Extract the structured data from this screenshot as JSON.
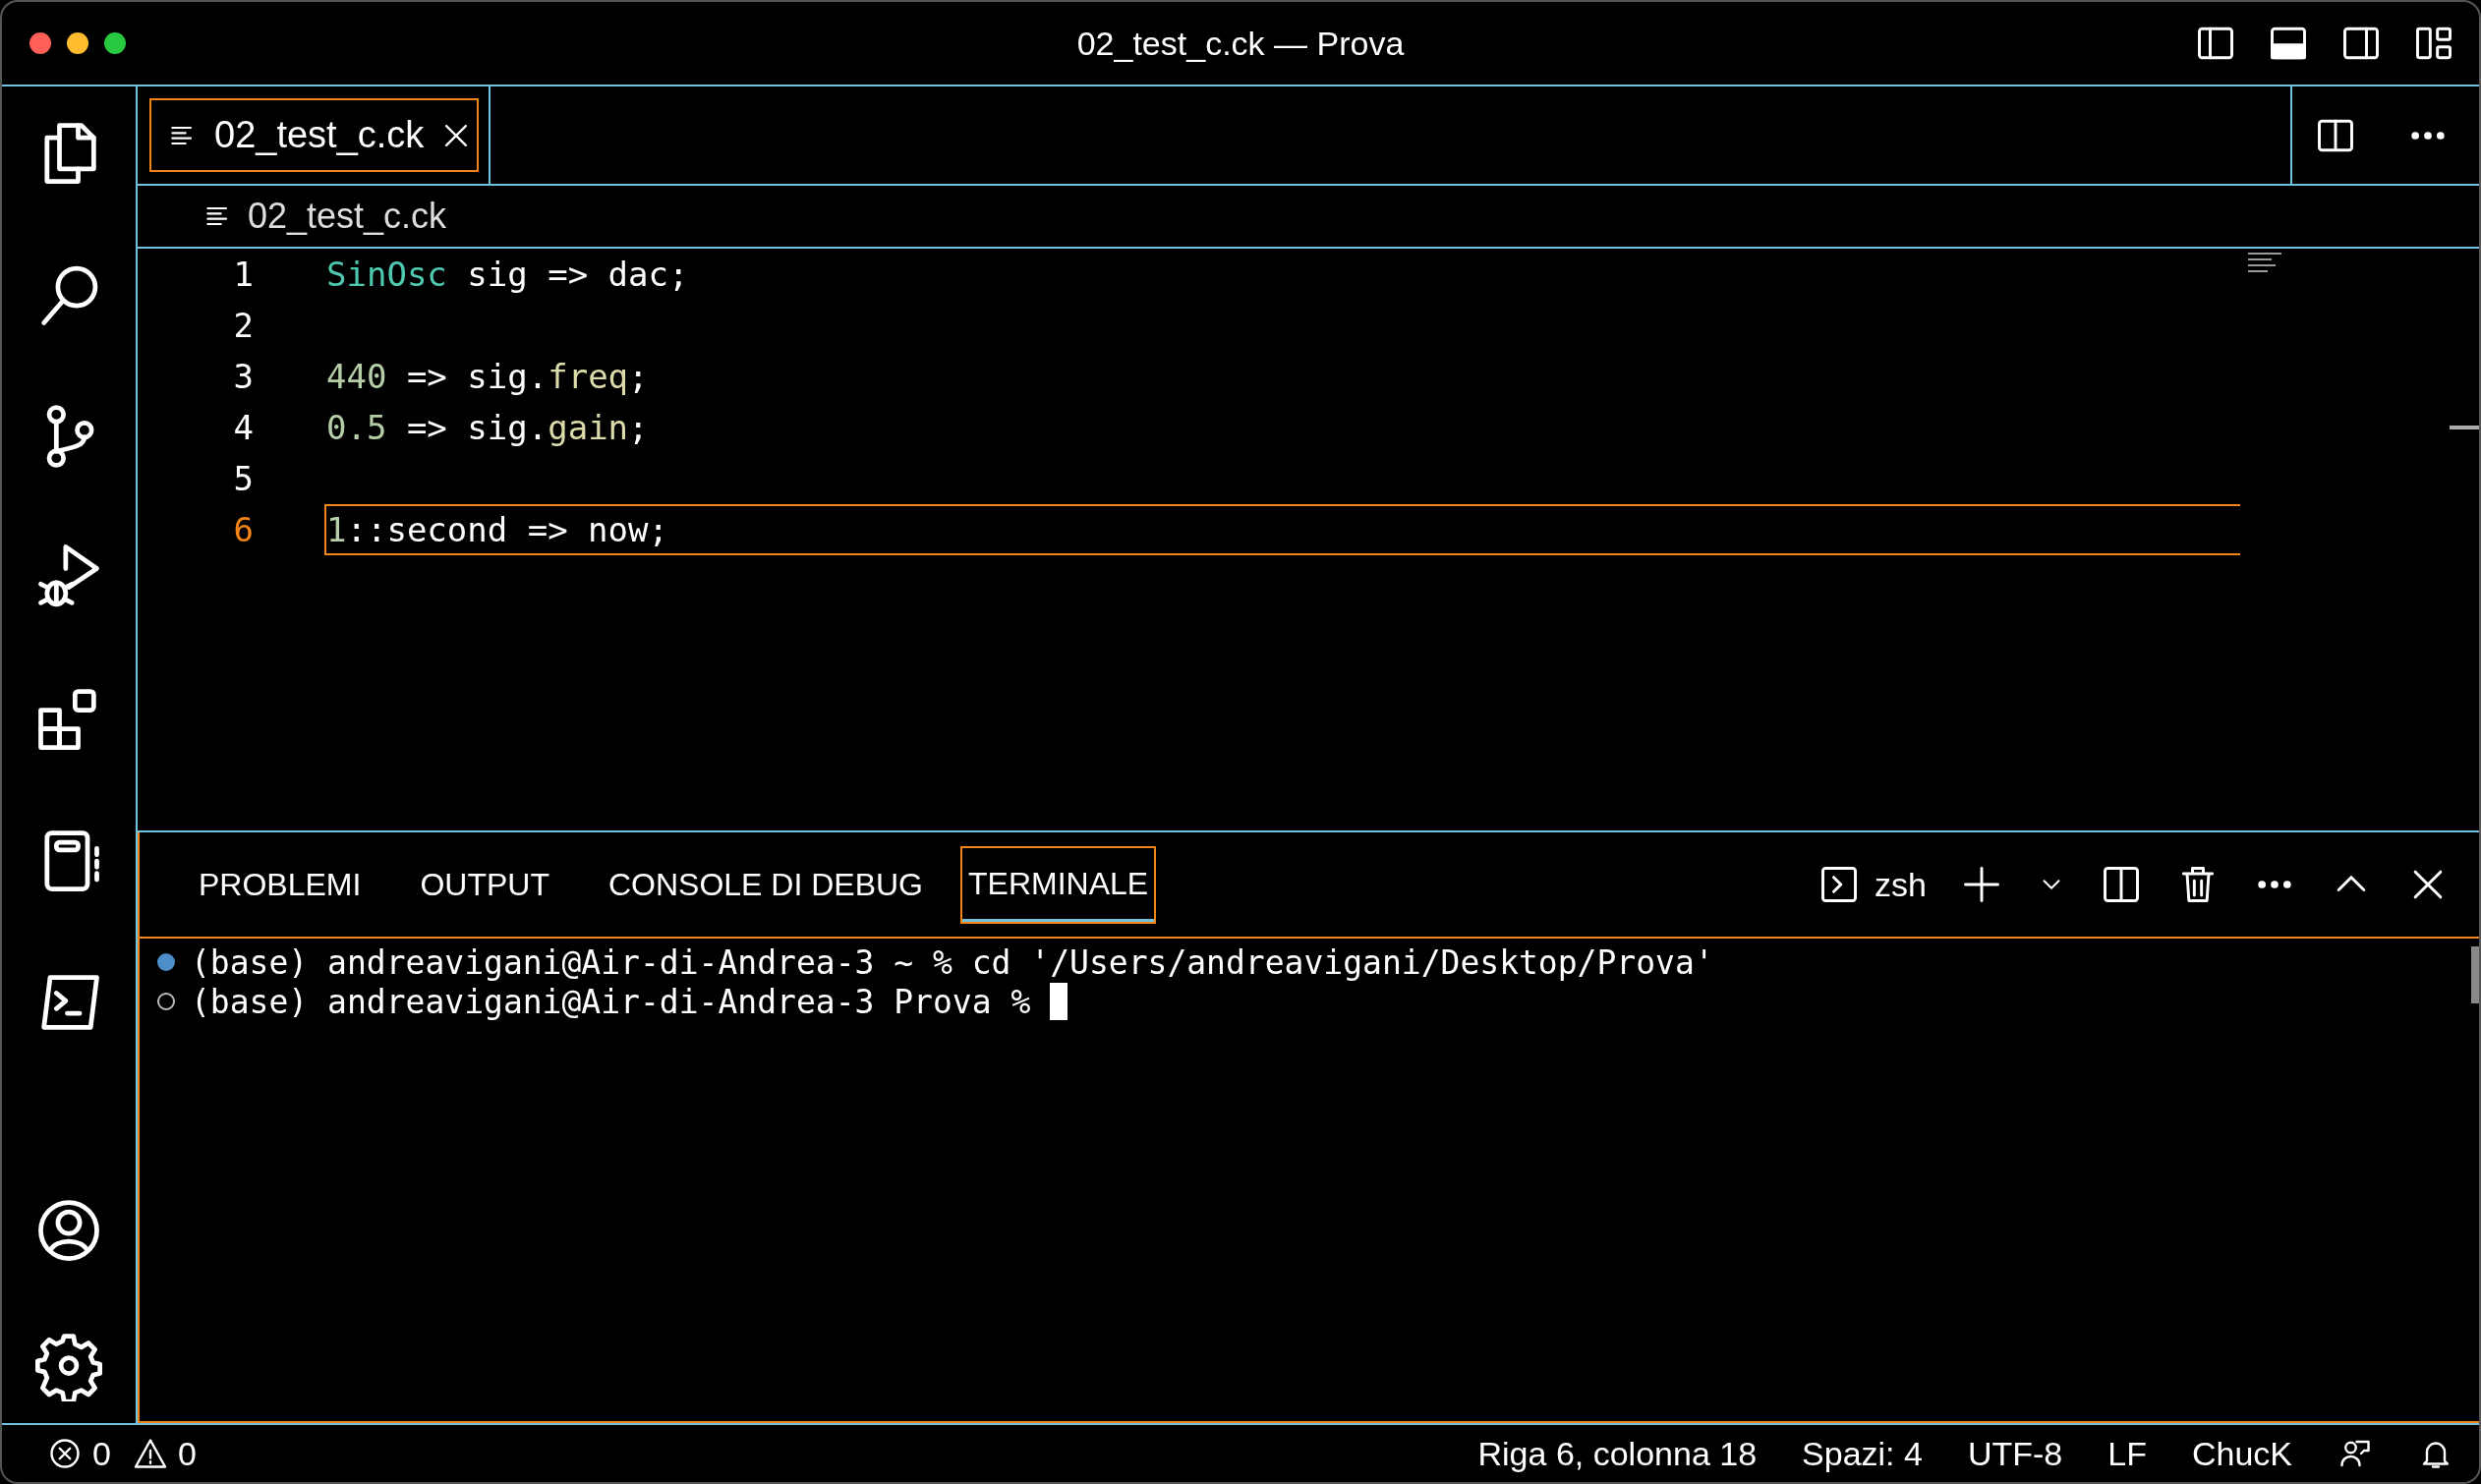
{
  "window": {
    "title": "02_test_c.ck — Prova"
  },
  "tabs": [
    {
      "label": "02_test_c.ck",
      "selected": true
    }
  ],
  "breadcrumb": "02_test_c.ck",
  "code_lines": [
    {
      "number": "1",
      "current": false,
      "tokens": [
        {
          "text": "SinOsc",
          "kind": "type"
        },
        {
          "text": " sig => dac;",
          "kind": "plain"
        }
      ]
    },
    {
      "number": "2",
      "current": false
    },
    {
      "number": "3",
      "current": false,
      "tokens": [
        {
          "text": "440",
          "kind": "number"
        },
        {
          "text": " => sig.",
          "kind": "plain"
        },
        {
          "text": "freq",
          "kind": "member"
        },
        {
          "text": ";",
          "kind": "plain"
        }
      ]
    },
    {
      "number": "4",
      "current": false,
      "tokens": [
        {
          "text": "0.5",
          "kind": "number"
        },
        {
          "text": " => sig.",
          "kind": "plain"
        },
        {
          "text": "gain",
          "kind": "member"
        },
        {
          "text": ";",
          "kind": "plain"
        }
      ]
    },
    {
      "number": "5",
      "current": false
    },
    {
      "number": "6",
      "current": true,
      "tokens": [
        {
          "text": "1",
          "kind": "number"
        },
        {
          "text": "::second => now;",
          "kind": "plain"
        }
      ]
    }
  ],
  "panel_tabs": [
    {
      "label": "PROBLEMI",
      "selected": false
    },
    {
      "label": "OUTPUT",
      "selected": false
    },
    {
      "label": "CONSOLE DI DEBUG",
      "selected": false
    },
    {
      "label": "TERMINALE",
      "selected": true
    }
  ],
  "terminal_shell": "zsh",
  "terminal_lines": [
    {
      "kind": "done",
      "text": "(base) andreavigani@Air-di-Andrea-3 ~ % cd '/Users/andreavigani/Desktop/Prova'"
    },
    {
      "kind": "idle",
      "text": "(base) andreavigani@Air-di-Andrea-3 Prova % ",
      "cursor": true
    }
  ],
  "status_bar": {
    "errors": "0",
    "warnings": "0",
    "items": [
      "Riga 6, colonna 18",
      "Spazi: 4",
      "UTF-8",
      "LF",
      "ChucK"
    ]
  }
}
